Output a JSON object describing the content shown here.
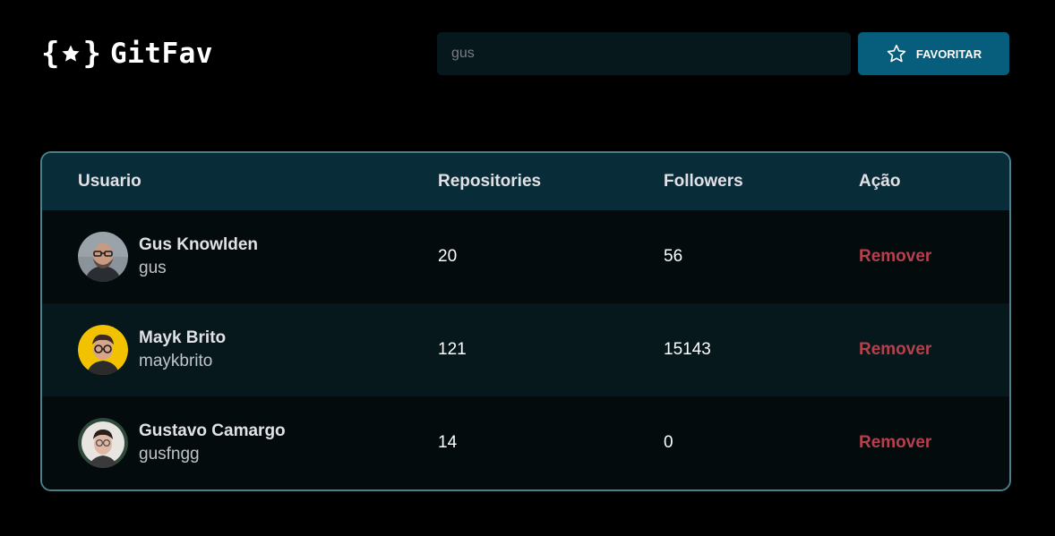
{
  "header": {
    "logo_text": "GitFav",
    "logo_brace_open": "{",
    "logo_brace_close": "}",
    "logo_icon": "star-icon",
    "search_value": "gus",
    "favorite_label": "FAVORITAR",
    "favorite_icon": "star-outline-icon"
  },
  "table": {
    "headers": {
      "user": "Usuario",
      "repositories": "Repositories",
      "followers": "Followers",
      "action": "Ação"
    },
    "rows": [
      {
        "name": "Gus Knowlden",
        "login": "gus",
        "repositories": "20",
        "followers": "56",
        "action": "Remover"
      },
      {
        "name": "Mayk Brito",
        "login": "maykbrito",
        "repositories": "121",
        "followers": "15143",
        "action": "Remover"
      },
      {
        "name": "Gustavo Camargo",
        "login": "gusfngg",
        "repositories": "14",
        "followers": "0",
        "action": "Remover"
      }
    ]
  },
  "colors": {
    "background": "#000000",
    "search_bg": "#06181C",
    "button_bg": "#065E7C",
    "table_header_bg": "#092D38",
    "table_border": "#4A808C",
    "row_odd_bg": "#030B0D",
    "row_even_bg": "#06181C",
    "remove_text": "#B6404C"
  }
}
